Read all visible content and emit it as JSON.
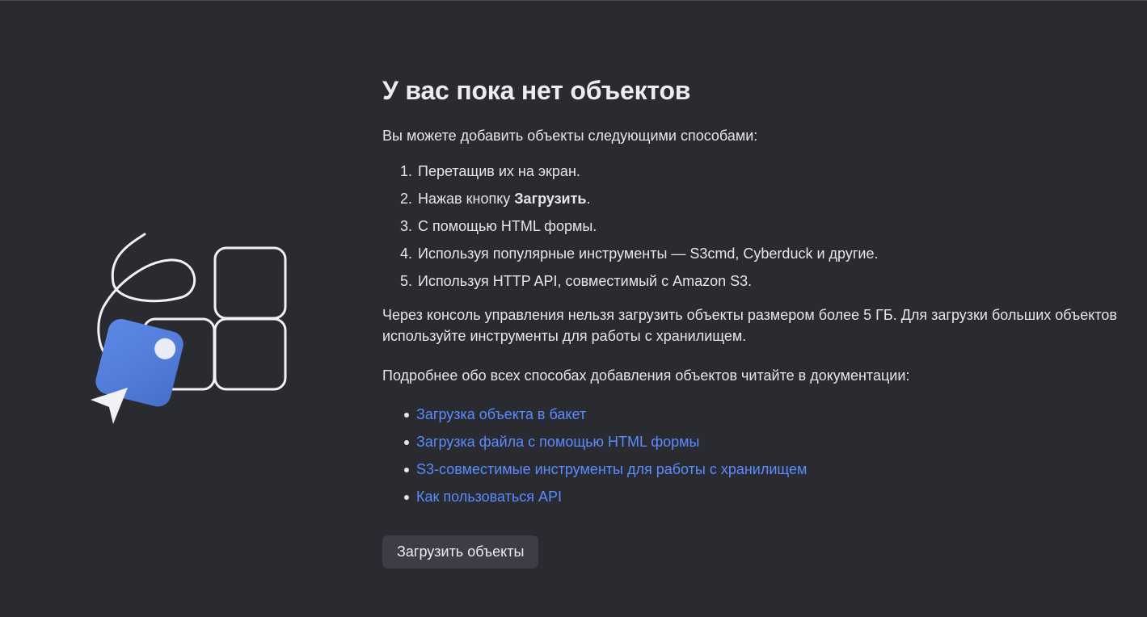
{
  "empty_state": {
    "title": "У вас пока нет объектов",
    "intro": "Вы можете добавить объекты следующими способами:",
    "methods": [
      {
        "text": "Перетащив их на экран."
      },
      {
        "before": "Нажав кнопку ",
        "bold": "Загрузить",
        "after": "."
      },
      {
        "text": "С помощью HTML формы."
      },
      {
        "text": "Используя популярные инструменты — S3cmd, Cyberduck и другие."
      },
      {
        "text": "Используя HTTP API, совместимый с Amazon S3."
      }
    ],
    "note": "Через консоль управления нельзя загрузить объекты размером более 5 ГБ. Для загрузки больших объектов используйте инструменты для работы с хранилищем.",
    "docs_lead": "Подробнее обо всех способах добавления объектов читайте в документации:",
    "doc_links": [
      "Загрузка объекта в бакет",
      "Загрузка файла с помощью HTML формы",
      "S3-совместимые инструменты для работы с хранилищем",
      "Как пользоваться API"
    ],
    "upload_button": "Загрузить объекты"
  },
  "colors": {
    "background": "#2a2a31",
    "link": "#5b8cff",
    "accent_tile": "#4e7de3",
    "button_bg": "#3d3d45"
  },
  "illustration": {
    "icons": [
      "grid-tiles-icon",
      "swirl-line-icon",
      "blue-object-tile-icon",
      "cursor-arrow-icon"
    ]
  }
}
